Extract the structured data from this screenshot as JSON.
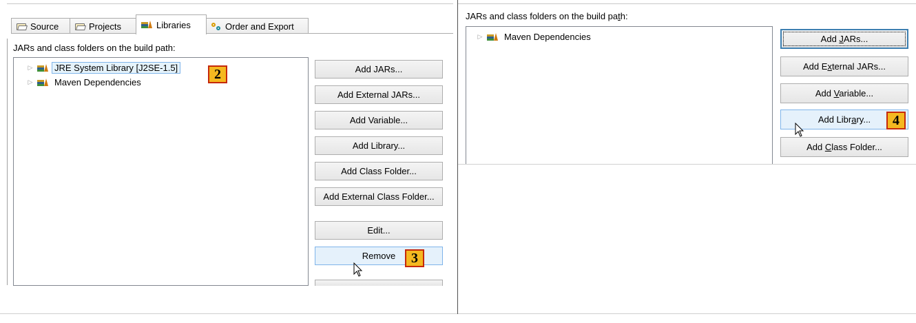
{
  "left": {
    "tabs": [
      {
        "label": "Source",
        "icon": "source-folder-icon"
      },
      {
        "label": "Projects",
        "icon": "projects-folder-icon"
      },
      {
        "label": "Libraries",
        "icon": "libraries-icon"
      },
      {
        "label": "Order and Export",
        "icon": "order-export-icon"
      }
    ],
    "active_tab": "Libraries",
    "section_label": "JARs and class folders on the build path:",
    "tree": [
      {
        "label": "JRE System Library [J2SE-1.5]",
        "selected": true
      },
      {
        "label": "Maven Dependencies",
        "selected": false
      }
    ],
    "buttons": {
      "add_jars": "Add JARs...",
      "add_external_jars": "Add External JARs...",
      "add_variable": "Add Variable...",
      "add_library": "Add Library...",
      "add_class_folder": "Add Class Folder...",
      "add_external_class_folder": "Add External Class Folder...",
      "edit": "Edit...",
      "remove": "Remove"
    },
    "badges": {
      "step2": "2",
      "step3": "3"
    }
  },
  "right": {
    "section_label_pre": "JARs and class folders on the build pa",
    "section_label_mn": "t",
    "section_label_post": "h:",
    "tree": [
      {
        "label": "Maven Dependencies"
      }
    ],
    "buttons": {
      "add_jars_pre": "Add ",
      "add_jars_mn": "J",
      "add_jars_post": "ARs...",
      "add_external_jars_pre": "Add E",
      "add_external_jars_mn": "x",
      "add_external_jars_post": "ternal JARs...",
      "add_variable_pre": "Add ",
      "add_variable_mn": "V",
      "add_variable_post": "ariable...",
      "add_library_pre": "Add Libr",
      "add_library_mn": "a",
      "add_library_post": "ry...",
      "add_class_folder_pre": "Add ",
      "add_class_folder_mn": "C",
      "add_class_folder_post": "lass Folder..."
    },
    "badges": {
      "step4": "4"
    }
  },
  "colors": {
    "badge_fill": "#f5b820",
    "badge_border": "#c5280a",
    "selection_border": "#7eb4ea",
    "hover_fill": "#e5f1fb"
  }
}
